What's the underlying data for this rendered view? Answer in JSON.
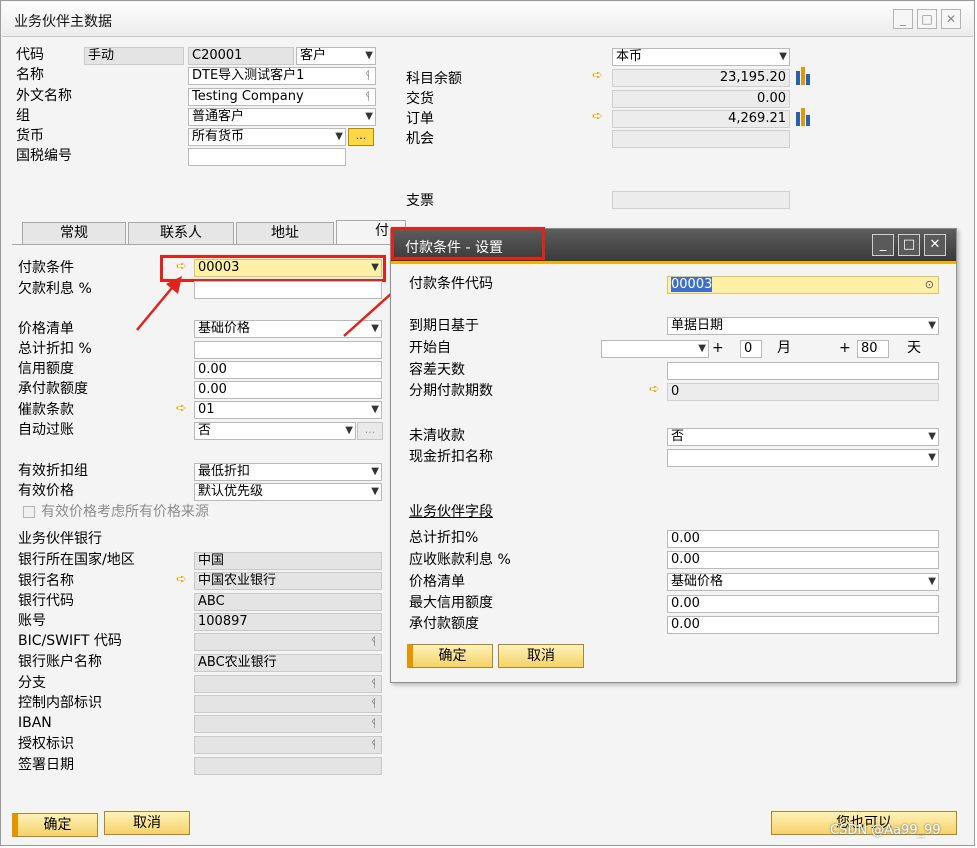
{
  "window": {
    "title": "业务伙伴主数据",
    "min": "_",
    "max": "□",
    "close": "✕"
  },
  "header": {
    "code_label": "代码",
    "code_mode": "手动",
    "code_value": "C20001",
    "type_value": "客户",
    "name_label": "名称",
    "name_value": "DTE导入测试客户1",
    "foreign_name_label": "外文名称",
    "foreign_name_value": "Testing Company",
    "group_label": "组",
    "group_value": "普通客户",
    "currency_label": "货币",
    "currency_value": "所有货币",
    "currency_btn": "...",
    "tax_label": "国税编号",
    "tax_value": ""
  },
  "summary": {
    "currency_select": "本币",
    "account_balance_label": "科目余额",
    "account_balance_value": "23,195.20",
    "delivery_label": "交货",
    "delivery_value": "0.00",
    "order_label": "订单",
    "order_value": "4,269.21",
    "opportunity_label": "机会",
    "opportunity_value": "",
    "check_label": "支票",
    "check_value": ""
  },
  "tabs": [
    "常规",
    "联系人",
    "地址",
    "付"
  ],
  "payment": {
    "terms_label": "付款条件",
    "terms_value": "00003",
    "interest_label": "欠款利息 %",
    "interest_value": "",
    "pricelist_label": "价格清单",
    "pricelist_value": "基础价格",
    "discount_label": "总计折扣 %",
    "discount_value": "",
    "credit_label": "信用额度",
    "credit_value": "0.00",
    "commit_label": "承付款额度",
    "commit_value": "0.00",
    "dunning_label": "催款条款",
    "dunning_value": "01",
    "autopost_label": "自动过账",
    "autopost_value": "否",
    "autopost_btn": "...",
    "eff_disc_label": "有效折扣组",
    "eff_disc_value": "最低折扣",
    "eff_price_label": "有效价格",
    "eff_price_value": "默认优先级",
    "eff_price_check_label": "有效价格考虑所有价格来源"
  },
  "bank": {
    "section_label": "业务伙伴银行",
    "country_label": "银行所在国家/地区",
    "country_value": "中国",
    "bank_name_label": "银行名称",
    "bank_name_value": "中国农业银行",
    "bank_code_label": "银行代码",
    "bank_code_value": "ABC",
    "account_label": "账号",
    "account_value": "100897",
    "swift_label": "BIC/SWIFT 代码",
    "swift_value": "",
    "account_name_label": "银行账户名称",
    "account_name_value": "ABC农业银行",
    "branch_label": "分支",
    "branch_value": "",
    "control_label": "控制内部标识",
    "control_value": "",
    "iban_label": "IBAN",
    "iban_value": "",
    "mandate_label": "授权标识",
    "mandate_value": "",
    "sign_label": "签署日期",
    "sign_value": ""
  },
  "footer": {
    "ok": "确定",
    "cancel": "取消",
    "also": "您也可以"
  },
  "watermark": "CSDN @Aa99_99",
  "dialog": {
    "title": "付款条件 - 设置",
    "code_label": "付款条件代码",
    "code_value": "00003",
    "due_label": "到期日基于",
    "due_value": "单据日期",
    "start_label": "开始自",
    "start_value": "",
    "plus": "+",
    "months_value": "0",
    "months_label": "月",
    "days_value": "80",
    "days_label": "天",
    "tolerance_label": "容差天数",
    "tolerance_value": "",
    "installments_label": "分期付款期数",
    "installments_value": "0",
    "open_label": "未清收款",
    "open_value": "否",
    "cashdisc_label": "现金折扣名称",
    "cashdisc_value": "",
    "bp_section": "业务伙伴字段",
    "total_disc_label": "总计折扣%",
    "total_disc_value": "0.00",
    "interest_label": "应收账款利息 %",
    "interest_value": "0.00",
    "pricelist_label": "价格清单",
    "pricelist_value": "基础价格",
    "max_credit_label": "最大信用额度",
    "max_credit_value": "0.00",
    "commit_label": "承付款额度",
    "commit_value": "0.00",
    "ok": "确定",
    "cancel": "取消"
  }
}
